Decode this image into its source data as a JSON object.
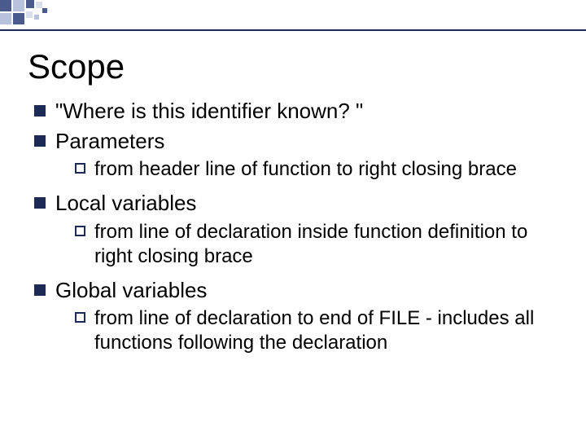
{
  "title": "Scope",
  "bullets": [
    {
      "text": "\"Where is this identifier known? \""
    },
    {
      "text": "Parameters",
      "children": [
        {
          "text": "from header line of function to right closing brace"
        }
      ]
    },
    {
      "text": "Local variables",
      "children": [
        {
          "text": "from line of declaration inside function definition to right closing brace"
        }
      ]
    },
    {
      "text": "Global variables",
      "children": [
        {
          "text": "from line of declaration to end of FILE - includes all functions following the declaration"
        }
      ]
    }
  ],
  "colors": {
    "accent": "#1c2a55",
    "light": "#b8c2dc",
    "lighter": "#d8deee"
  }
}
